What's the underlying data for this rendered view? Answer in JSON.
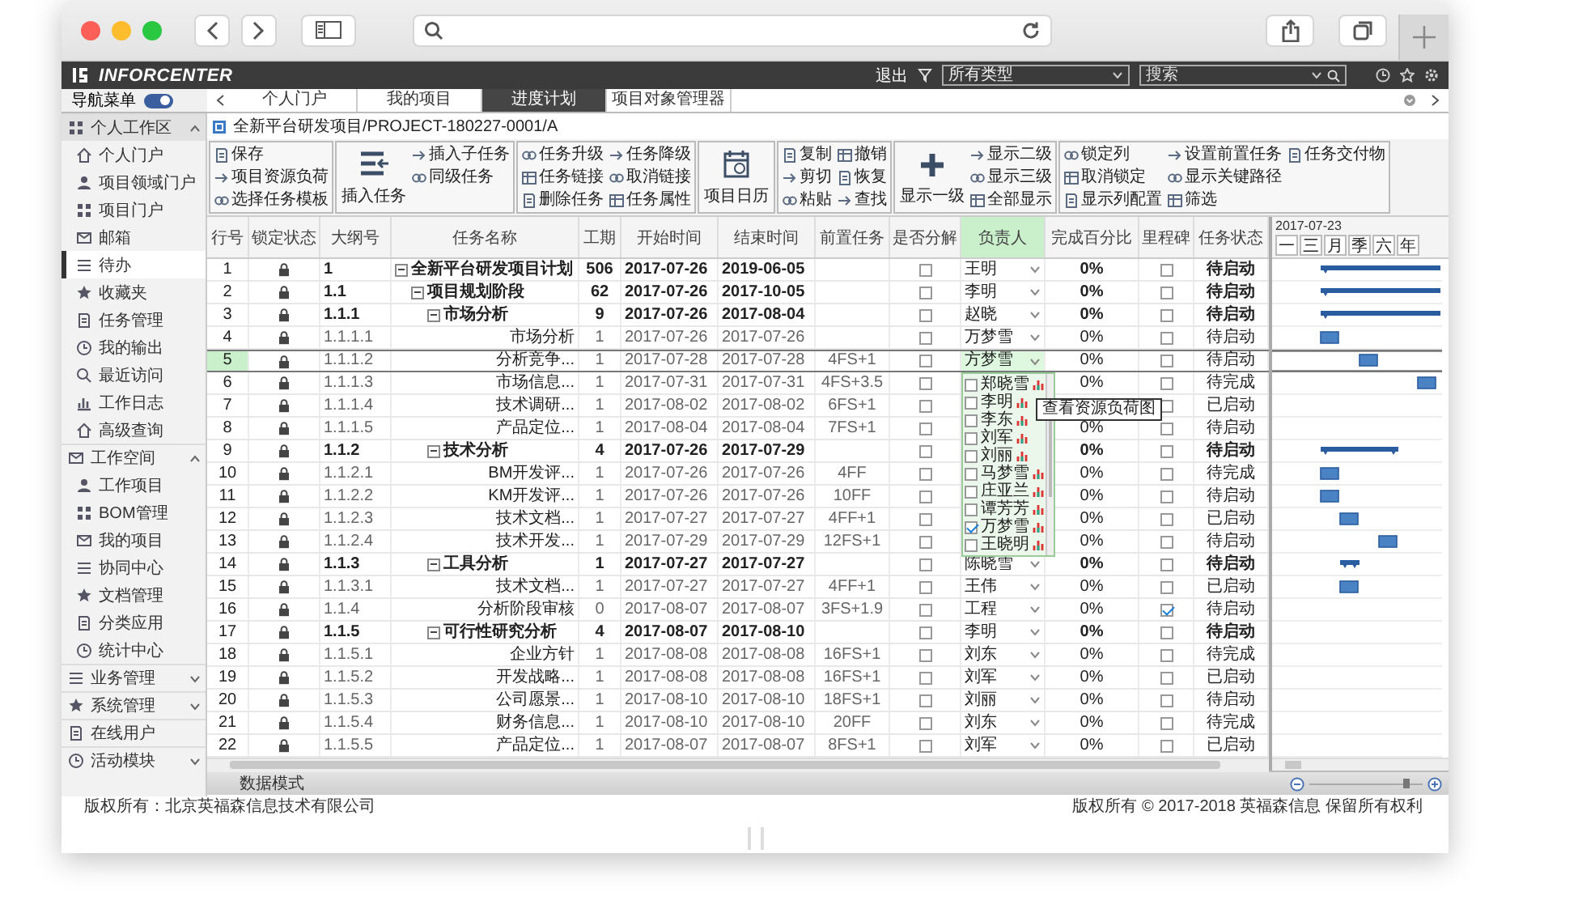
{
  "app": {
    "brand": "INFORCENTER",
    "exit": "退出",
    "type_select": "所有类型",
    "search_placeholder": "搜索"
  },
  "tabs_bar": {
    "toggle_label": "导航菜单",
    "toggle_on": true,
    "tabs": [
      {
        "label": "个人门户",
        "selected": false
      },
      {
        "label": "我的项目",
        "selected": false
      },
      {
        "label": "进度计划",
        "selected": true
      },
      {
        "label": "项目对象管理器",
        "selected": false
      }
    ]
  },
  "nav": {
    "groups": [
      {
        "label": "个人工作区",
        "expanded": true,
        "selected": true,
        "items": [
          {
            "label": "个人门户",
            "selected": false
          },
          {
            "label": "项目领域门户",
            "selected": false
          },
          {
            "label": "项目门户",
            "selected": false
          },
          {
            "label": "邮箱",
            "selected": false
          },
          {
            "label": "待办",
            "selected": true
          },
          {
            "label": "收藏夹",
            "selected": false
          },
          {
            "label": "任务管理",
            "selected": false
          },
          {
            "label": "我的输出",
            "selected": false
          },
          {
            "label": "最近访问",
            "selected": false
          },
          {
            "label": "工作日志",
            "selected": false
          },
          {
            "label": "高级查询",
            "selected": false
          }
        ]
      },
      {
        "label": "工作空间",
        "expanded": true,
        "selected": false,
        "items": [
          {
            "label": "工作项目",
            "selected": false
          },
          {
            "label": "BOM管理",
            "selected": false
          },
          {
            "label": "我的项目",
            "selected": false
          },
          {
            "label": "协同中心",
            "selected": false
          },
          {
            "label": "文档管理",
            "selected": false
          },
          {
            "label": "分类应用",
            "selected": false
          },
          {
            "label": "统计中心",
            "selected": false
          }
        ]
      },
      {
        "label": "业务管理",
        "expanded": false,
        "selected": false
      },
      {
        "label": "系统管理",
        "expanded": false,
        "selected": false
      },
      {
        "label": "在线用户",
        "selected": false
      },
      {
        "label": "活动模块",
        "expanded": false,
        "selected": false
      }
    ]
  },
  "breadcrumb": "全新平台研发项目/PROJECT-180227-0001/A",
  "ribbon": [
    {
      "kind": "small",
      "items": [
        "保存",
        "项目资源负荷",
        "选择任务模板"
      ]
    },
    {
      "kind": "big",
      "big": "插入任务",
      "items": [
        "插入子任务",
        "同级任务"
      ]
    },
    {
      "kind": "small",
      "items": [
        "任务升级",
        "任务链接",
        "删除任务",
        "任务降级",
        "取消链接",
        "任务属性"
      ]
    },
    {
      "kind": "big",
      "big": "项目日历"
    },
    {
      "kind": "small",
      "items": [
        "复制",
        "剪切",
        "粘贴",
        "撤销",
        "恢复",
        "查找"
      ]
    },
    {
      "kind": "big",
      "big": "显示一级",
      "items": [
        "显示二级",
        "显示三级",
        "全部显示"
      ]
    },
    {
      "kind": "small",
      "items": [
        "锁定列",
        "取消锁定",
        "显示列配置",
        "设置前置任务",
        "显示关键路径",
        "筛选",
        "任务交付物"
      ]
    }
  ],
  "grid": {
    "columns": [
      {
        "kind": "row",
        "label": "行号",
        "highlighted": false
      },
      {
        "kind": "lock",
        "label": "锁定状态",
        "highlighted": false
      },
      {
        "kind": "outline",
        "label": "大纲号",
        "highlighted": false
      },
      {
        "kind": "name",
        "label": "任务名称",
        "highlighted": false
      },
      {
        "kind": "duration",
        "label": "工期",
        "highlighted": false
      },
      {
        "kind": "start",
        "label": "开始时间",
        "highlighted": false
      },
      {
        "kind": "end",
        "label": "结束时间",
        "highlighted": false
      },
      {
        "kind": "pred",
        "label": "前置任务",
        "highlighted": false
      },
      {
        "kind": "decompose",
        "label": "是否分解",
        "highlighted": false
      },
      {
        "kind": "owner",
        "label": "负责人",
        "highlighted": true
      },
      {
        "kind": "percent",
        "label": "完成百分比",
        "highlighted": false
      },
      {
        "kind": "milestone",
        "label": "里程碑",
        "highlighted": false
      },
      {
        "kind": "status",
        "label": "任务状态",
        "highlighted": false
      }
    ],
    "tasks": [
      {
        "row": "1",
        "outline": "1",
        "name": "全新平台研发项目计划",
        "duration": "506",
        "start": "2017-07-26",
        "end": "2019-06-05",
        "owner": "王明",
        "percent": "0%",
        "status": "待启动",
        "kind": "summary",
        "expanded": true,
        "selected": false,
        "decompose": false,
        "milestone": false,
        "children": [
          {
            "row": "2",
            "outline": "1.1",
            "name": "项目规划阶段",
            "duration": "62",
            "start": "2017-07-26",
            "end": "2017-10-05",
            "owner": "李明",
            "percent": "0%",
            "status": "待启动",
            "kind": "summary",
            "expanded": true,
            "selected": false,
            "decompose": false,
            "milestone": false,
            "children": [
              {
                "row": "3",
                "outline": "1.1.1",
                "name": "市场分析",
                "duration": "9",
                "start": "2017-07-26",
                "end": "2017-08-04",
                "owner": "赵晓",
                "percent": "0%",
                "status": "待启动",
                "kind": "summary",
                "expanded": true,
                "selected": false,
                "decompose": false,
                "milestone": false,
                "children": [
                  {
                    "row": "4",
                    "outline": "1.1.1.1",
                    "name": "市场分析",
                    "duration": "1",
                    "start": "2017-07-26",
                    "end": "2017-07-26",
                    "owner": "万梦雪",
                    "percent": "0%",
                    "status": "待启动",
                    "kind": "task",
                    "selected": false,
                    "decompose": false,
                    "milestone": false
                  },
                  {
                    "row": "5",
                    "outline": "1.1.1.2",
                    "name": "分析竞争...",
                    "duration": "1",
                    "start": "2017-07-28",
                    "end": "2017-07-28",
                    "pred": "4FS+1",
                    "owner": "方梦雪",
                    "percent": "0%",
                    "status": "待启动",
                    "kind": "task",
                    "selected": true,
                    "decompose": false,
                    "milestone": false
                  },
                  {
                    "row": "6",
                    "outline": "1.1.1.3",
                    "name": "市场信息...",
                    "duration": "1",
                    "start": "2017-07-31",
                    "end": "2017-07-31",
                    "pred": "4FS+3.5",
                    "percent": "0%",
                    "status": "待完成",
                    "kind": "task",
                    "selected": false,
                    "decompose": false,
                    "milestone": false
                  },
                  {
                    "row": "7",
                    "outline": "1.1.1.4",
                    "name": "技术调研...",
                    "duration": "1",
                    "start": "2017-08-02",
                    "end": "2017-08-02",
                    "pred": "6FS+1",
                    "status": "已启动",
                    "kind": "task",
                    "selected": false,
                    "decompose": false,
                    "milestone": false
                  },
                  {
                    "row": "8",
                    "outline": "1.1.1.5",
                    "name": "产品定位...",
                    "duration": "1",
                    "start": "2017-08-04",
                    "end": "2017-08-04",
                    "pred": "7FS+1",
                    "percent": "0%",
                    "status": "待启动",
                    "kind": "task",
                    "selected": false,
                    "decompose": false,
                    "milestone": false
                  }
                ]
              },
              {
                "row": "9",
                "outline": "1.1.2",
                "name": "技术分析",
                "duration": "4",
                "start": "2017-07-26",
                "end": "2017-07-29",
                "percent": "0%",
                "status": "待启动",
                "kind": "summary",
                "expanded": true,
                "selected": false,
                "decompose": false,
                "milestone": false,
                "children": [
                  {
                    "row": "10",
                    "outline": "1.1.2.1",
                    "name": "BM开发评...",
                    "duration": "1",
                    "start": "2017-07-26",
                    "end": "2017-07-26",
                    "pred": "4FF",
                    "percent": "0%",
                    "status": "待完成",
                    "kind": "task",
                    "selected": false,
                    "decompose": false,
                    "milestone": false
                  },
                  {
                    "row": "11",
                    "outline": "1.1.2.2",
                    "name": "KM开发评...",
                    "duration": "1",
                    "start": "2017-07-26",
                    "end": "2017-07-26",
                    "pred": "10FF",
                    "percent": "0%",
                    "status": "待启动",
                    "kind": "task",
                    "selected": false,
                    "decompose": false,
                    "milestone": false
                  },
                  {
                    "row": "12",
                    "outline": "1.1.2.3",
                    "name": "技术文档...",
                    "duration": "1",
                    "start": "2017-07-27",
                    "end": "2017-07-27",
                    "pred": "4FF+1",
                    "percent": "0%",
                    "status": "已启动",
                    "kind": "task",
                    "selected": false,
                    "decompose": false,
                    "milestone": false
                  },
                  {
                    "row": "13",
                    "outline": "1.1.2.4",
                    "name": "技术开发...",
                    "duration": "1",
                    "start": "2017-07-29",
                    "end": "2017-07-29",
                    "pred": "12FS+1",
                    "percent": "0%",
                    "status": "待启动",
                    "kind": "task",
                    "selected": false,
                    "decompose": false,
                    "milestone": false
                  }
                ]
              },
              {
                "row": "14",
                "outline": "1.1.3",
                "name": "工具分析",
                "duration": "1",
                "start": "2017-07-27",
                "end": "2017-07-27",
                "owner": "陈晓雪",
                "percent": "0%",
                "status": "待启动",
                "kind": "summary",
                "expanded": true,
                "selected": false,
                "decompose": false,
                "milestone": false,
                "children": [
                  {
                    "row": "15",
                    "outline": "1.1.3.1",
                    "name": "技术文档...",
                    "duration": "1",
                    "start": "2017-07-27",
                    "end": "2017-07-27",
                    "pred": "4FF+1",
                    "owner": "王伟",
                    "percent": "0%",
                    "status": "已启动",
                    "kind": "task",
                    "selected": false,
                    "decompose": false,
                    "milestone": false
                  }
                ]
              },
              {
                "row": "16",
                "outline": "1.1.4",
                "name": "分析阶段审核",
                "duration": "0",
                "start": "2017-08-07",
                "end": "2017-08-07",
                "pred": "3FS+1.9",
                "owner": "工程",
                "percent": "0%",
                "status": "待启动",
                "kind": "task",
                "selected": false,
                "decompose": false,
                "milestone": true
              },
              {
                "row": "17",
                "outline": "1.1.5",
                "name": "可行性研究分析",
                "duration": "4",
                "start": "2017-08-07",
                "end": "2017-08-10",
                "owner": "李明",
                "percent": "0%",
                "status": "待启动",
                "kind": "summary",
                "expanded": true,
                "selected": false,
                "decompose": false,
                "milestone": false,
                "children": [
                  {
                    "row": "18",
                    "outline": "1.1.5.1",
                    "name": "企业方针",
                    "duration": "1",
                    "start": "2017-08-08",
                    "end": "2017-08-08",
                    "pred": "16FS+1",
                    "owner": "刘东",
                    "percent": "0%",
                    "status": "待完成",
                    "kind": "task",
                    "selected": false,
                    "decompose": false,
                    "milestone": false
                  },
                  {
                    "row": "19",
                    "outline": "1.1.5.2",
                    "name": "开发战略...",
                    "duration": "1",
                    "start": "2017-08-08",
                    "end": "2017-08-08",
                    "pred": "16FS+1",
                    "owner": "刘军",
                    "percent": "0%",
                    "status": "已启动",
                    "kind": "task",
                    "selected": false,
                    "decompose": false,
                    "milestone": false
                  },
                  {
                    "row": "20",
                    "outline": "1.1.5.3",
                    "name": "公司愿景...",
                    "duration": "1",
                    "start": "2017-08-10",
                    "end": "2017-08-10",
                    "pred": "18FS+1",
                    "owner": "刘丽",
                    "percent": "0%",
                    "status": "待启动",
                    "kind": "task",
                    "selected": false,
                    "decompose": false,
                    "milestone": false
                  },
                  {
                    "row": "21",
                    "outline": "1.1.5.4",
                    "name": "财务信息...",
                    "duration": "1",
                    "start": "2017-08-10",
                    "end": "2017-08-10",
                    "pred": "20FF",
                    "owner": "刘东",
                    "percent": "0%",
                    "status": "待完成",
                    "kind": "task",
                    "selected": false,
                    "decompose": false,
                    "milestone": false
                  },
                  {
                    "row": "22",
                    "outline": "1.1.5.5",
                    "name": "产品定位...",
                    "duration": "1",
                    "start": "2017-08-07",
                    "end": "2017-08-07",
                    "pred": "8FS+1",
                    "owner": "刘军",
                    "percent": "0%",
                    "status": "已启动",
                    "kind": "task",
                    "selected": false,
                    "decompose": false,
                    "milestone": false
                  }
                ]
              }
            ]
          }
        ]
      }
    ],
    "owner_dropdown": {
      "items": [
        {
          "label": "郑晓雪",
          "checked": false
        },
        {
          "label": "李明",
          "checked": false
        },
        {
          "label": "李东",
          "checked": false
        },
        {
          "label": "刘军",
          "checked": false
        },
        {
          "label": "刘丽",
          "checked": false
        },
        {
          "label": "马梦雪",
          "checked": false
        },
        {
          "label": "庄亚兰",
          "checked": false
        },
        {
          "label": "谭芳芳",
          "checked": false
        },
        {
          "label": "万梦雪",
          "checked": true
        },
        {
          "label": "王晓明",
          "checked": false
        }
      ],
      "tooltip": "查看资源负荷图"
    }
  },
  "gantt": {
    "date": "2017-07-23",
    "scales": [
      "一",
      "三",
      "月",
      "季",
      "六",
      "年"
    ]
  },
  "footer": {
    "mode_tab": "数据模式",
    "zoom": {
      "level": 0.85
    }
  },
  "bottom": {
    "left": "版权所有：北京英福森信息技术有限公司",
    "right": "版权所有 © 2017-2018 英福森信息 保留所有权利"
  }
}
